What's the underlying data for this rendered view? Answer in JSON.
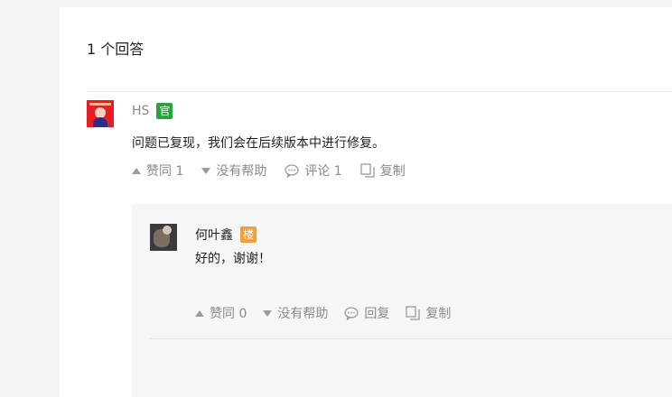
{
  "header": {
    "answers_count": "1 个回答"
  },
  "answer": {
    "username": "HS",
    "badge": "官",
    "content": "问题已复现，我们会在后续版本中进行修复。",
    "actions": {
      "like": "赞同 1",
      "dislike": "没有帮助",
      "comment": "评论 1",
      "copy": "复制"
    }
  },
  "reply": {
    "username": "何叶鑫",
    "badge": "楼",
    "content": "好的，谢谢！",
    "actions": {
      "like": "赞同 0",
      "dislike": "没有帮助",
      "reply": "回复",
      "copy": "复制"
    }
  },
  "colors": {
    "official_badge": "#25a43a",
    "op_badge": "#f29e3a",
    "muted_text": "#8a8a8a"
  },
  "icons": [
    "upvote-icon",
    "downvote-icon",
    "comment-icon",
    "copy-icon"
  ]
}
